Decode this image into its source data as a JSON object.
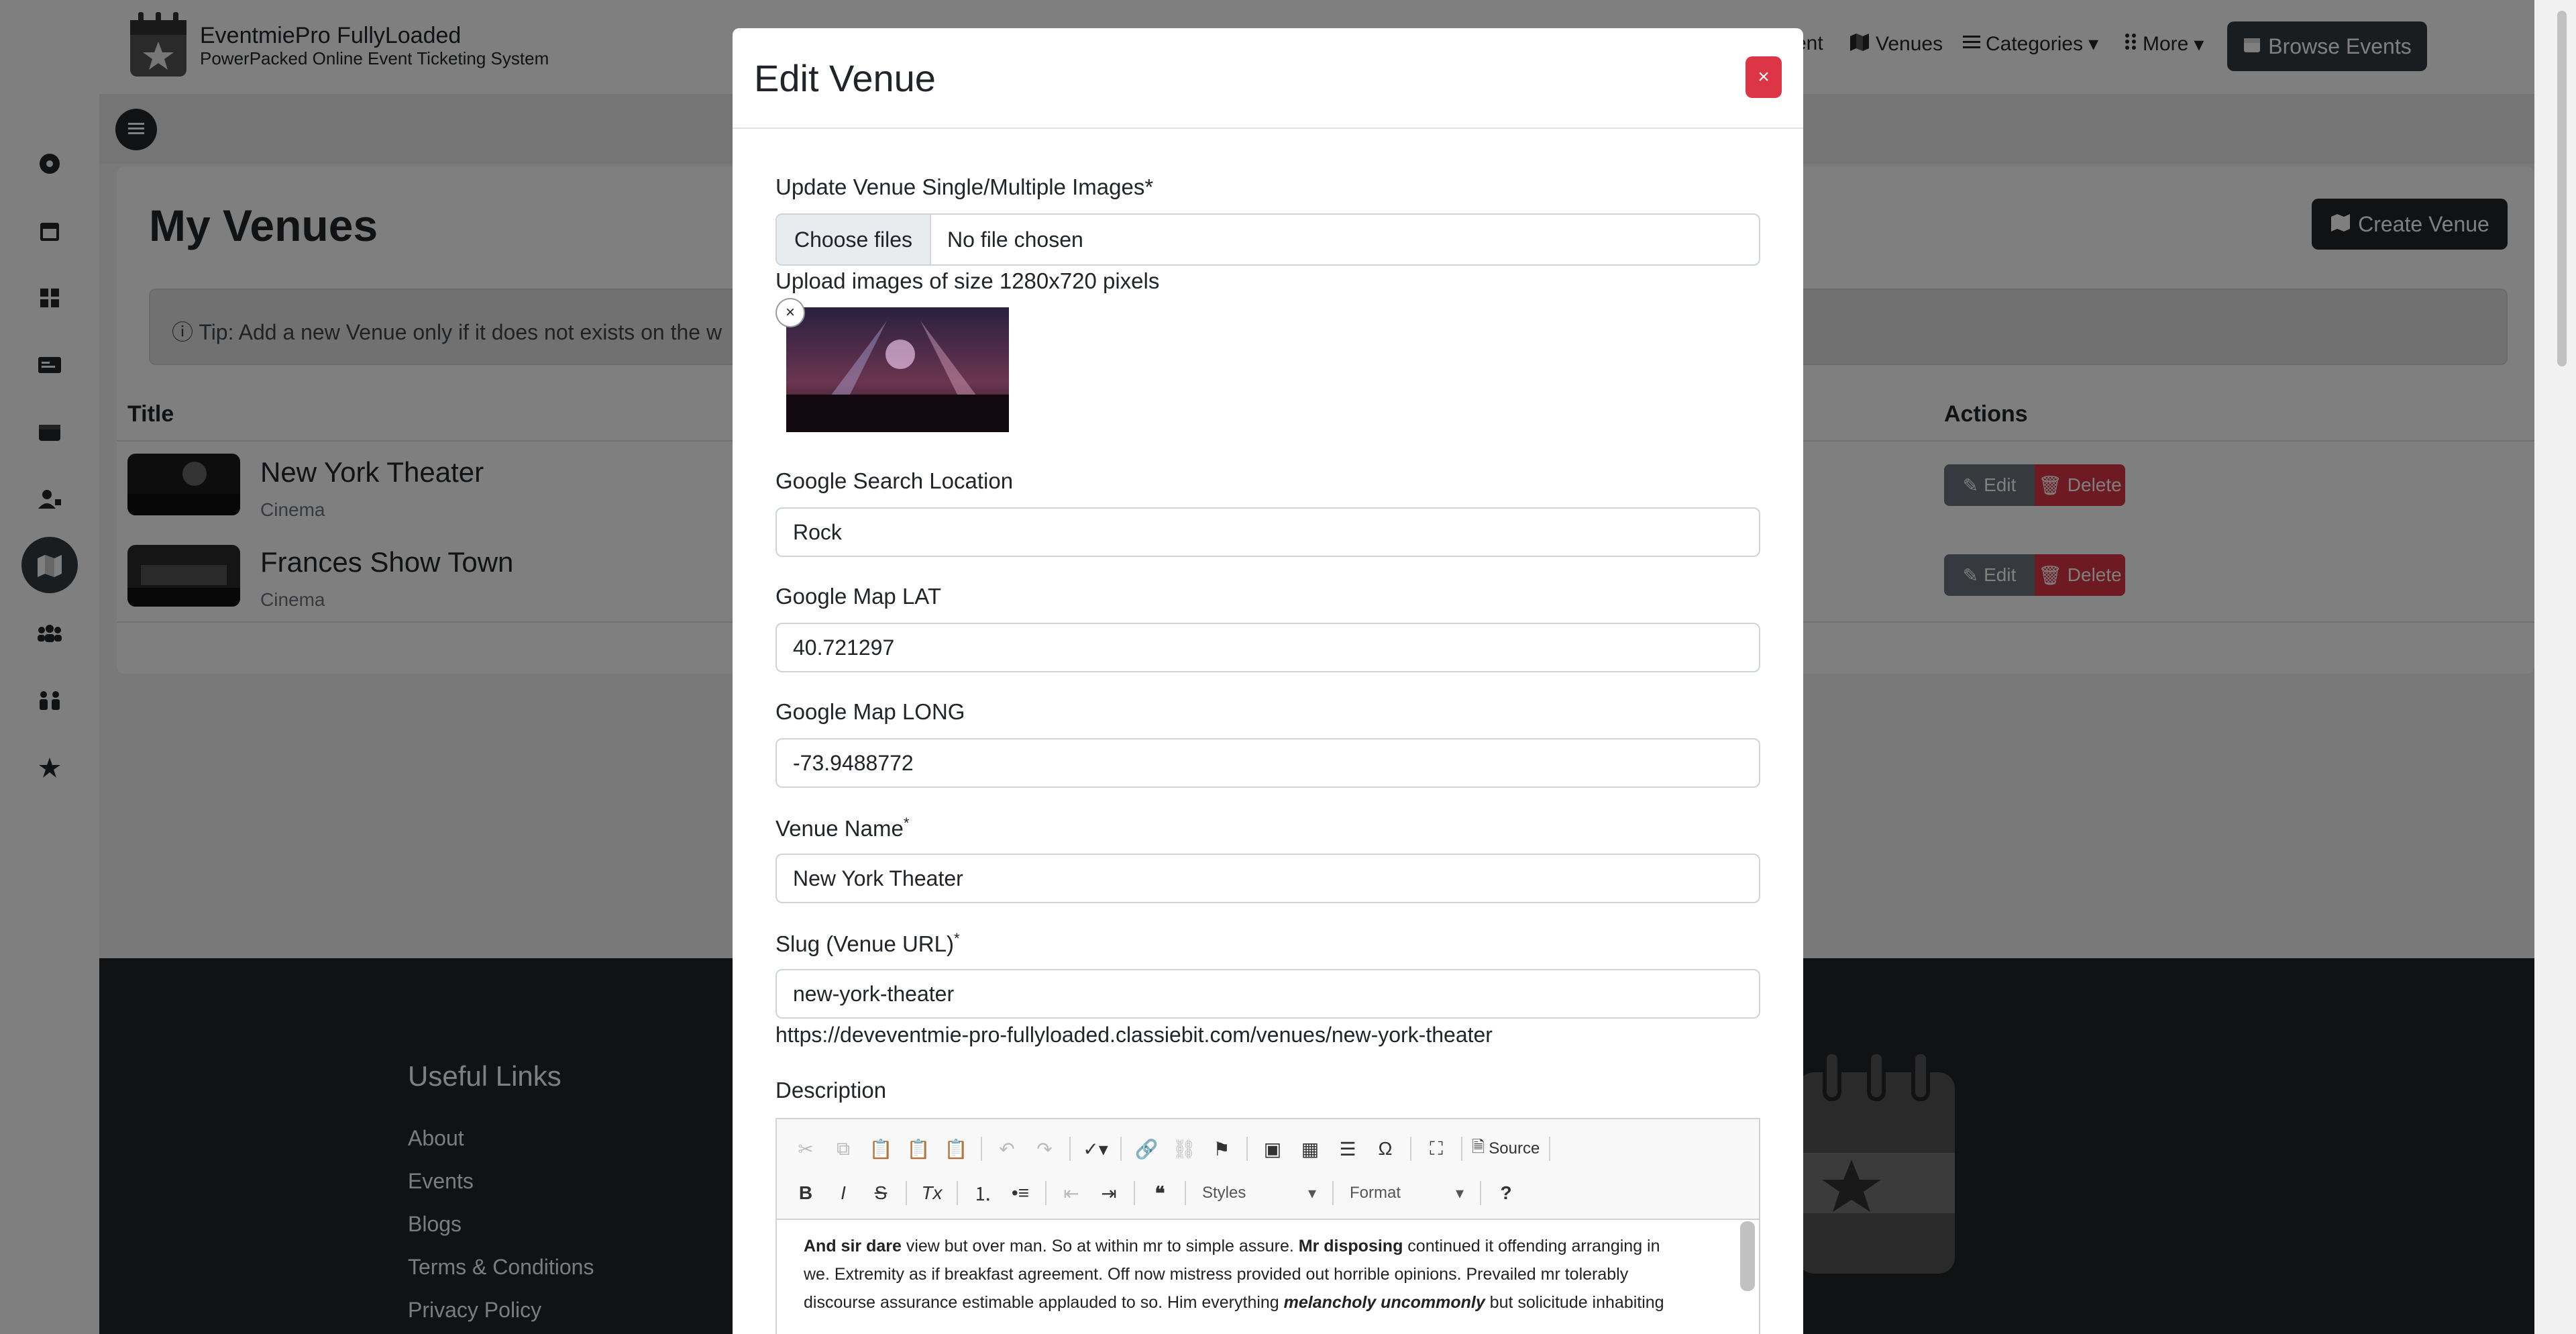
{
  "brand": {
    "name": "EventmiePro FullyLoaded",
    "tagline": "PowerPacked Online Event Ticketing System"
  },
  "topnav": {
    "partial": "ent",
    "venues": "Venues",
    "categories": "Categories",
    "more": "More",
    "browse": "Browse Events"
  },
  "sidebar": {
    "icons": [
      "dashboard-icon",
      "calendar-icon",
      "grid-icon",
      "id-card-icon",
      "wallet-icon",
      "user-icon",
      "map-icon",
      "users-icon",
      "people-icon",
      "star-icon"
    ],
    "active": "map-icon"
  },
  "page": {
    "title": "My Venues",
    "create_label": "Create Venue",
    "tip": "Tip: Add a new Venue only if it does not exists on the w"
  },
  "table": {
    "headers": [
      "Title",
      "Actions"
    ],
    "rows": [
      {
        "title": "New York Theater",
        "type": "Cinema",
        "edit": "Edit",
        "delete": "Delete"
      },
      {
        "title": "Frances Show Town",
        "type": "Cinema",
        "edit": "Edit",
        "delete": "Delete"
      }
    ]
  },
  "footer": {
    "heading": "Useful Links",
    "links": [
      "About",
      "Events",
      "Blogs",
      "Terms & Conditions",
      "Privacy Policy"
    ]
  },
  "modal": {
    "title": "Edit Venue",
    "close_label": "×",
    "images_label": "Update Venue Single/Multiple Images*",
    "file_button": "Choose files",
    "file_status": "No file chosen",
    "images_hint": "Upload images of size 1280x720 pixels",
    "remove_image": "×",
    "location_label": "Google Search Location",
    "location_value": "Rock",
    "lat_label": "Google Map LAT",
    "lat_value": "40.721297",
    "long_label": "Google Map LONG",
    "long_value": "-73.9488772",
    "name_label": "Venue Name",
    "name_value": "New York Theater",
    "slug_label": "Slug (Venue URL)",
    "slug_value": "new-york-theater",
    "required_mark": "*",
    "url": "https://deveventmie-pro-fullyloaded.classiebit.com/venues/new-york-theater",
    "description_label": "Description",
    "editor": {
      "source_label": "Source",
      "styles_label": "Styles",
      "format_label": "Format",
      "line1_b1": "And sir dare",
      "line1_t1": " view but over man. So at within mr to simple assure. ",
      "line1_b2": "Mr disposing",
      "line1_t2": " continued it offending arranging in",
      "line2": "we. Extremity as if breakfast agreement. Off now mistress provided out horrible opinions. Prevailed mr tolerably",
      "line3_t1": "discourse assurance estimable applauded to so. Him everything ",
      "line3_bi": "melancholy uncommonly",
      "line3_t2": " but solicitude inhabiting"
    }
  },
  "colors": {
    "dark": "#212529",
    "danger": "#dc3545",
    "secondary": "#6c757d",
    "overlay": "rgba(0,0,0,0.5)"
  }
}
